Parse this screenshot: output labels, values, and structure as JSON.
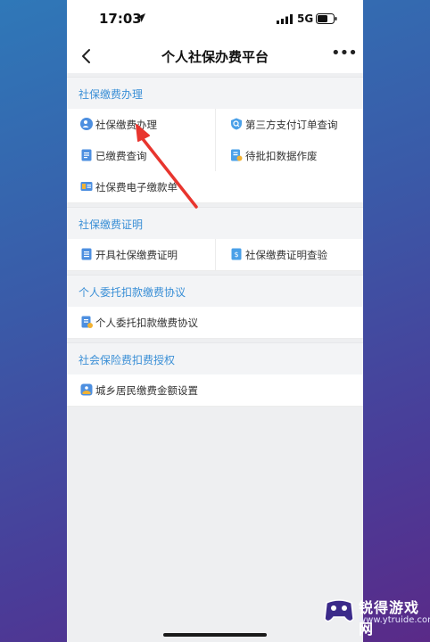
{
  "status_bar": {
    "time": "17:03",
    "network": "5G"
  },
  "nav": {
    "title": "个人社保办费平台"
  },
  "sections": [
    {
      "title": "社保缴费办理",
      "items": [
        "社保缴费办理",
        "第三方支付订单查询",
        "已缴费查询",
        "待批扣数据作废",
        "社保费电子缴款单"
      ]
    },
    {
      "title": "社保缴费证明",
      "items": [
        "开具社保缴费证明",
        "社保缴费证明查验"
      ]
    },
    {
      "title": "个人委托扣款缴费协议",
      "items": [
        "个人委托扣款缴费协议"
      ]
    },
    {
      "title": "社会保险费扣费授权",
      "items": [
        "城乡居民缴费金额设置"
      ]
    }
  ],
  "watermark": {
    "title": "锐得游戏网",
    "url": "www.ytruide.com"
  },
  "colors": {
    "accent": "#3a8fd6",
    "annotation_arrow": "#e8352e"
  }
}
